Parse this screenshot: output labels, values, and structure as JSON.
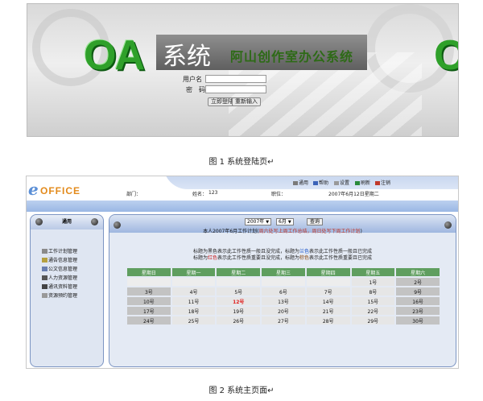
{
  "figure1": {
    "logo_text": "OA",
    "system_text": "系统",
    "company_name": "阿山创作室办公系统",
    "username_label": "用户名",
    "password_label": "密　码",
    "login_button": "立即登陆",
    "reset_button": "重新输入",
    "caption": "图 1 系统登陆页↵"
  },
  "figure2": {
    "logo": {
      "e": "e",
      "office": "OFFICE"
    },
    "toolbar": [
      "通用",
      "帮助",
      "设置",
      "刷新",
      "注销"
    ],
    "header_info": {
      "dept_label": "部门：",
      "name_label": "姓名：",
      "name_value": "123",
      "position_label": "职位：",
      "date_text": "2007年6月12日星期二"
    },
    "sidebar": {
      "title": "通用",
      "items": [
        "工作计划管理",
        "通告信息管理",
        "公文信息管理",
        "人力资源管理",
        "通讯资料管理",
        "资源预约管理"
      ]
    },
    "filter": {
      "year": "2007年",
      "month": "6月",
      "query_button": "查询"
    },
    "plan_line": {
      "prefix": "本人2007年6月工作计划(",
      "red_part": "周六处写上周工作总结，周日处写下周工作计划",
      "suffix": ")"
    },
    "legend_line1": [
      "标题为黑色表示此工作性质一般且没完成，标题为",
      "兰色",
      "表示此工作性质一般且已完成"
    ],
    "legend_line2": [
      "标题为",
      "红色",
      "表示此工作性质重要且没完成，标题为",
      "棕色",
      "表示此工作性质重要且已完成"
    ],
    "calendar": {
      "headers": [
        "星期日",
        "星期一",
        "星期二",
        "星期三",
        "星期四",
        "星期五",
        "星期六"
      ],
      "rows": [
        [
          "",
          "",
          "",
          "",
          "",
          "1号",
          "2号"
        ],
        [
          "3号",
          "4号",
          "5号",
          "6号",
          "7号",
          "8号",
          "9号"
        ],
        [
          "10号",
          "11号",
          "12号",
          "13号",
          "14号",
          "15号",
          "16号"
        ],
        [
          "17号",
          "18号",
          "19号",
          "20号",
          "21号",
          "22号",
          "23号"
        ],
        [
          "24号",
          "25号",
          "26号",
          "27号",
          "28号",
          "29号",
          "30号"
        ]
      ],
      "today": "12号"
    },
    "caption": "图 2 系统主页面↵",
    "colors": {
      "header_green": "#5f9e5f",
      "brand_orange": "#e38a1b",
      "brand_blue": "#5b8fd6",
      "today_red": "#e02020"
    }
  }
}
